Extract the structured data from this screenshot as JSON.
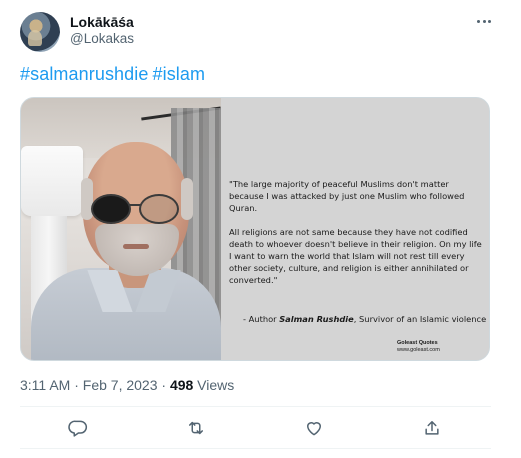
{
  "author": {
    "display_name": "Lokākāśa",
    "handle": "@Lokakas"
  },
  "tweet": {
    "hashtags": [
      "#salmanrushdie",
      "#islam"
    ],
    "timestamp": "3:11 AM · Feb 7, 2023 · ",
    "views_count": "498",
    "views_label": " Views"
  },
  "image": {
    "quote_p1": "\"The large majority of peaceful Muslims don't matter because I was attacked by just one Muslim who followed Quran.",
    "quote_p2": "All religions are not same because they have not codified death to whoever doesn't believe in their religion. On my life I want to warn the world that Islam will not rest till every other society, culture, and religion is either annihilated or converted.\"",
    "attribution_prefix": "- Author ",
    "attribution_name": "Salman Rushdie",
    "attribution_suffix": ", Survivor of an Islamic violence",
    "brand_name": "Goleast Quotes",
    "brand_url": "www.goleast.com"
  },
  "actions": {
    "reply_icon": "reply-icon",
    "retweet_icon": "retweet-icon",
    "like_icon": "like-icon",
    "share_icon": "share-icon"
  },
  "colors": {
    "hashtag": "#1d9bf0",
    "secondary_text": "#536471",
    "primary_text": "#0f1419"
  }
}
